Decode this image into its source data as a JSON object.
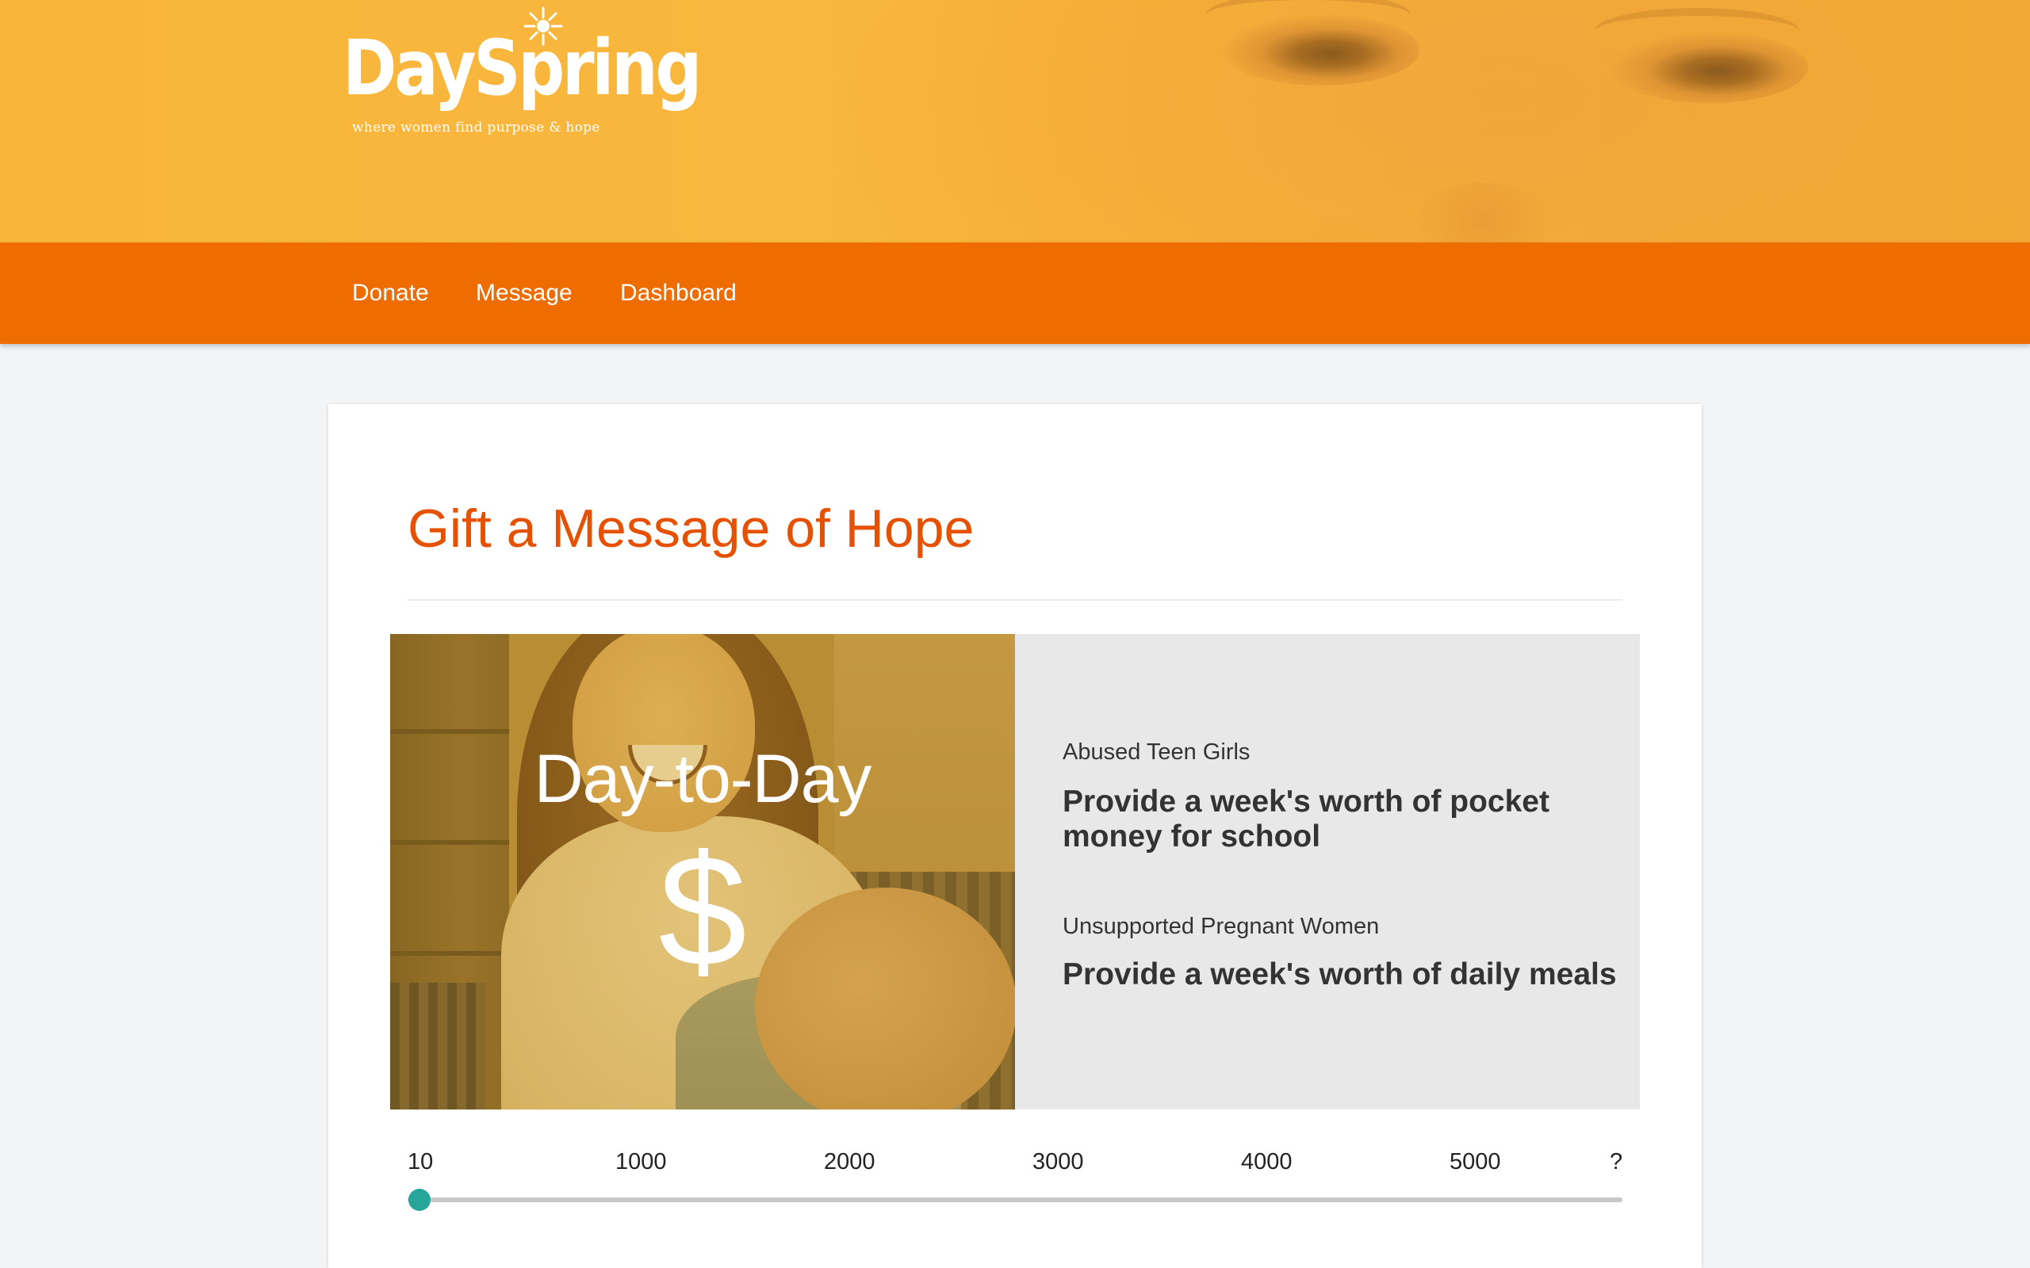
{
  "header": {
    "logo_text": "DaySpring",
    "tagline": "where women find purpose & hope"
  },
  "nav": {
    "items": [
      {
        "label": "Donate"
      },
      {
        "label": "Message"
      },
      {
        "label": "Dashboard"
      }
    ]
  },
  "card": {
    "title": "Gift a Message of Hope"
  },
  "promo": {
    "label": "Day-to-Day",
    "symbol": "$",
    "items": [
      {
        "category": "Abused Teen Girls",
        "description": "Provide a week's worth of pocket money for school"
      },
      {
        "category": "Unsupported Pregnant Women",
        "description": "Provide a week's worth of daily meals"
      }
    ]
  },
  "slider": {
    "ticks": [
      "10",
      "1000",
      "2000",
      "3000",
      "4000",
      "5000",
      "?"
    ],
    "value": 10
  },
  "colors": {
    "header_bg": "#f9b73d",
    "nav_bg": "#ef6c00",
    "title": "#e65100",
    "slider_thumb": "#26a69a",
    "page_bg": "#f3f4f5"
  }
}
